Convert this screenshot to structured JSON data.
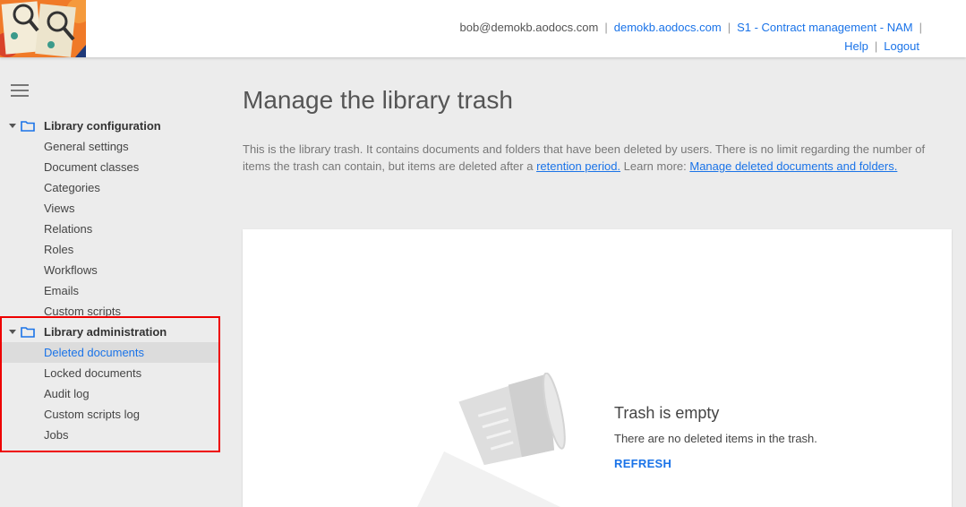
{
  "header": {
    "user_email": "bob@demokb.aodocs.com",
    "domain_link": "demokb.aodocs.com",
    "library_link": "S1 - Contract management - NAM",
    "help_link": "Help",
    "logout_link": "Logout"
  },
  "sidebar": {
    "sections": [
      {
        "title": "Library configuration",
        "items": [
          "General settings",
          "Document classes",
          "Categories",
          "Views",
          "Relations",
          "Roles",
          "Workflows",
          "Emails",
          "Custom scripts"
        ]
      },
      {
        "title": "Library administration",
        "items": [
          "Deleted documents",
          "Locked documents",
          "Audit log",
          "Custom scripts log",
          "Jobs"
        ]
      }
    ],
    "active_item": "Deleted documents"
  },
  "main": {
    "title": "Manage the library trash",
    "description_part1": "This is the library trash. It contains documents and folders that have been deleted by users. There is no limit regarding the number of items the trash can contain, but items are deleted after a ",
    "retention_link": "retention period.",
    "description_part2": " Learn more: ",
    "learn_more_link": "Manage deleted documents and folders.",
    "empty_title": "Trash is empty",
    "empty_text": "There are no deleted items in the trash.",
    "refresh_label": "REFRESH"
  },
  "colors": {
    "accent": "#1a73e8",
    "highlight_border": "#ee0000",
    "background": "#ececec"
  }
}
